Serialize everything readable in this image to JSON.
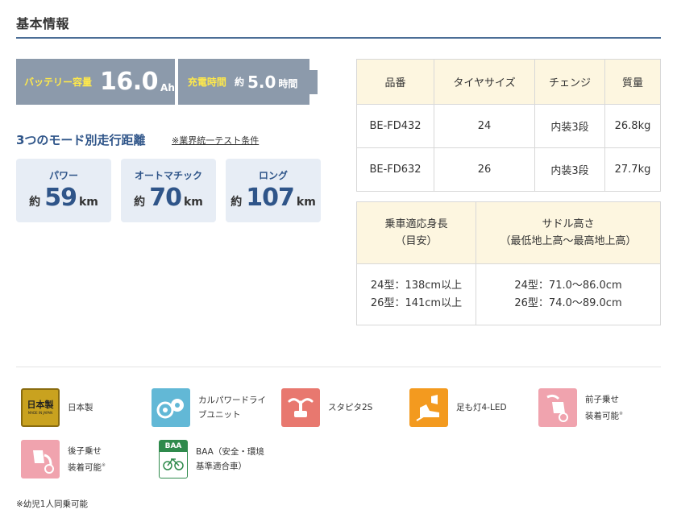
{
  "section_title": "基本情報",
  "battery": {
    "capacity_label": "バッテリー容量",
    "capacity_value": "16.0",
    "capacity_unit": "Ah",
    "charge_label": "充電時間",
    "charge_prefix": "約",
    "charge_value": "5.0",
    "charge_unit": "時間"
  },
  "modes": {
    "title": "3つのモード別走行距離",
    "note": "※業界統一テスト条件",
    "items": [
      {
        "name": "パワー",
        "prefix": "約",
        "value": "59",
        "unit": "km"
      },
      {
        "name": "オートマチック",
        "prefix": "約",
        "value": "70",
        "unit": "km"
      },
      {
        "name": "ロング",
        "prefix": "約",
        "value": "107",
        "unit": "km"
      }
    ]
  },
  "spec_table": {
    "headers": [
      "品番",
      "タイヤサイズ",
      "チェンジ",
      "質量"
    ],
    "rows": [
      [
        "BE-FD432",
        "24",
        "内装3段",
        "26.8kg"
      ],
      [
        "BE-FD632",
        "26",
        "内装3段",
        "27.7kg"
      ]
    ]
  },
  "size_table": {
    "header1_line1": "乗車適応身長",
    "header1_line2": "（目安）",
    "header2_line1": "サドル高さ",
    "header2_line2": "（最低地上高〜最高地上高）",
    "col1_line1": "24型：138cm以上",
    "col1_line2": "26型：141cm以上",
    "col2_line1": "24型：71.0〜86.0cm",
    "col2_line2": "26型：74.0〜89.0cm"
  },
  "features": [
    {
      "icon": "made-in-japan-badge-icon",
      "label1": "日本製",
      "label2": "",
      "note": "",
      "icon_text1": "日本製",
      "icon_text2": "MADE IN JAPAN",
      "color": "#c9a21f"
    },
    {
      "icon": "power-drive-unit-icon",
      "label1": "カルパワードライ",
      "label2": "ブユニット",
      "note": "",
      "color": "#62b8d6"
    },
    {
      "icon": "handlebar-icon",
      "label1": "スタピタ2S",
      "label2": "",
      "note": "",
      "color": "#e8786f"
    },
    {
      "icon": "led-light-icon",
      "label1": "足も灯4-LED",
      "label2": "",
      "note": "",
      "color": "#f39a1f"
    },
    {
      "icon": "front-child-seat-icon",
      "label1": "前子乗せ",
      "label2": "装着可能",
      "note": "※",
      "color": "#f0a3ae"
    },
    {
      "icon": "rear-child-seat-icon",
      "label1": "後子乗せ",
      "label2": "装着可能",
      "note": "※",
      "color": "#f0a3ae"
    },
    {
      "icon": "baa-mark-icon",
      "label1": "BAA（安全・環境",
      "label2": "基準適合車）",
      "note": "",
      "icon_text1": "BAA",
      "color": "#2f8a4c"
    }
  ],
  "footnote": "※幼児1人同乗可能"
}
